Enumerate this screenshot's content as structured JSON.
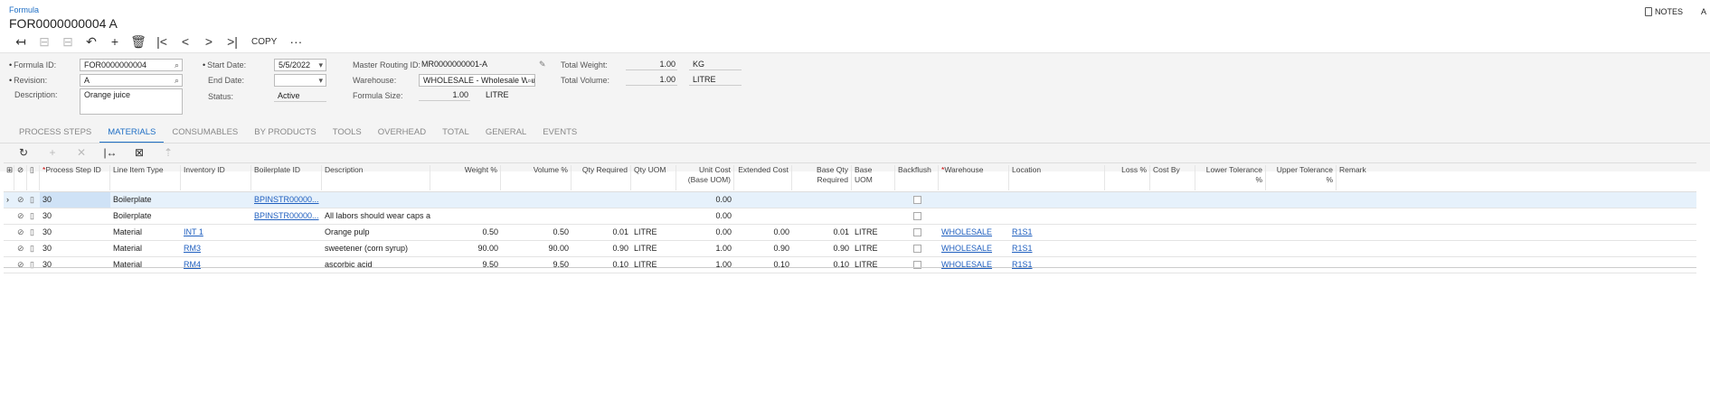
{
  "header": {
    "breadcrumb": "Formula",
    "title": "FOR0000000004 A",
    "notes_label": "NOTES",
    "overflow_label": "A"
  },
  "toolbar": {
    "back": "↤",
    "save_close": "⊟",
    "save": "⊟",
    "undo": "↶",
    "add": "+",
    "delete": "🗑",
    "first": "|<",
    "prev": "<",
    "next": ">",
    "last": ">|",
    "copy_label": "COPY",
    "more": "···"
  },
  "form": {
    "formula_id_label": "Formula ID:",
    "formula_id_value": "FOR0000000004",
    "revision_label": "Revision:",
    "revision_value": "A",
    "description_label": "Description:",
    "description_value": "Orange juice",
    "start_date_label": "Start Date:",
    "start_date_value": "5/5/2022",
    "end_date_label": "End Date:",
    "end_date_value": "",
    "status_label": "Status:",
    "status_value": "Active",
    "master_routing_label": "Master Routing ID:",
    "master_routing_value": "MR0000000001-A",
    "warehouse_label": "Warehouse:",
    "warehouse_value": "WHOLESALE - Wholesale Ware",
    "formula_size_label": "Formula Size:",
    "formula_size_value": "1.00",
    "formula_size_uom": "LITRE",
    "total_weight_label": "Total Weight:",
    "total_weight_value": "1.00",
    "total_weight_uom": "KG",
    "total_volume_label": "Total Volume:",
    "total_volume_value": "1.00",
    "total_volume_uom": "LITRE"
  },
  "tabs": [
    {
      "label": "PROCESS STEPS",
      "active": false
    },
    {
      "label": "MATERIALS",
      "active": true
    },
    {
      "label": "CONSUMABLES",
      "active": false
    },
    {
      "label": "BY PRODUCTS",
      "active": false
    },
    {
      "label": "TOOLS",
      "active": false
    },
    {
      "label": "OVERHEAD",
      "active": false
    },
    {
      "label": "TOTAL",
      "active": false
    },
    {
      "label": "GENERAL",
      "active": false
    },
    {
      "label": "EVENTS",
      "active": false
    }
  ],
  "grid_toolbar": {
    "refresh": "↻",
    "add": "+",
    "delete": "✕",
    "fit": "|↔",
    "export": "⊠",
    "upload": "⇡"
  },
  "columns": {
    "process_step": "Process Step ID",
    "line_item_type": "Line Item Type",
    "inventory_id": "Inventory ID",
    "boilerplate_id": "Boilerplate ID",
    "description": "Description",
    "weight_pct": "Weight %",
    "volume_pct": "Volume %",
    "qty_required": "Qty Required",
    "qty_uom": "Qty UOM",
    "unit_cost": "Unit Cost (Base UOM)",
    "extended_cost": "Extended Cost",
    "base_qty_required": "Base Qty Required",
    "base_uom": "Base UOM",
    "backflush": "Backflush",
    "warehouse": "Warehouse",
    "location": "Location",
    "loss_pct": "Loss %",
    "cost_by": "Cost By",
    "lower_tolerance": "Lower Tolerance %",
    "upper_tolerance": "Upper Tolerance %",
    "remark": "Remark"
  },
  "rows": [
    {
      "process_step": "30",
      "line_item_type": "Boilerplate",
      "inventory_id": "",
      "boilerplate_id": "BPINSTR00000...",
      "description": "",
      "weight_pct": "",
      "volume_pct": "",
      "qty_required": "",
      "qty_uom": "",
      "unit_cost": "0.00",
      "extended_cost": "",
      "base_qty_required": "",
      "base_uom": "",
      "warehouse": "",
      "location": ""
    },
    {
      "process_step": "30",
      "line_item_type": "Boilerplate",
      "inventory_id": "",
      "boilerplate_id": "BPINSTR00000...",
      "description": "All labors should wear caps a...",
      "weight_pct": "",
      "volume_pct": "",
      "qty_required": "",
      "qty_uom": "",
      "unit_cost": "0.00",
      "extended_cost": "",
      "base_qty_required": "",
      "base_uom": "",
      "warehouse": "",
      "location": ""
    },
    {
      "process_step": "30",
      "line_item_type": "Material",
      "inventory_id": "INT 1",
      "boilerplate_id": "",
      "description": "Orange pulp",
      "weight_pct": "0.50",
      "volume_pct": "0.50",
      "qty_required": "0.01",
      "qty_uom": "LITRE",
      "unit_cost": "0.00",
      "extended_cost": "0.00",
      "base_qty_required": "0.01",
      "base_uom": "LITRE",
      "warehouse": "WHOLESALE",
      "location": "R1S1"
    },
    {
      "process_step": "30",
      "line_item_type": "Material",
      "inventory_id": "RM3",
      "boilerplate_id": "",
      "description": "sweetener (corn syrup)",
      "weight_pct": "90.00",
      "volume_pct": "90.00",
      "qty_required": "0.90",
      "qty_uom": "LITRE",
      "unit_cost": "1.00",
      "extended_cost": "0.90",
      "base_qty_required": "0.90",
      "base_uom": "LITRE",
      "warehouse": "WHOLESALE",
      "location": "R1S1"
    },
    {
      "process_step": "30",
      "line_item_type": "Material",
      "inventory_id": "RM4",
      "boilerplate_id": "",
      "description": "ascorbic acid",
      "weight_pct": "9.50",
      "volume_pct": "9.50",
      "qty_required": "0.10",
      "qty_uom": "LITRE",
      "unit_cost": "1.00",
      "extended_cost": "0.10",
      "base_qty_required": "0.10",
      "base_uom": "LITRE",
      "warehouse": "WHOLESALE",
      "location": "R1S1"
    }
  ]
}
